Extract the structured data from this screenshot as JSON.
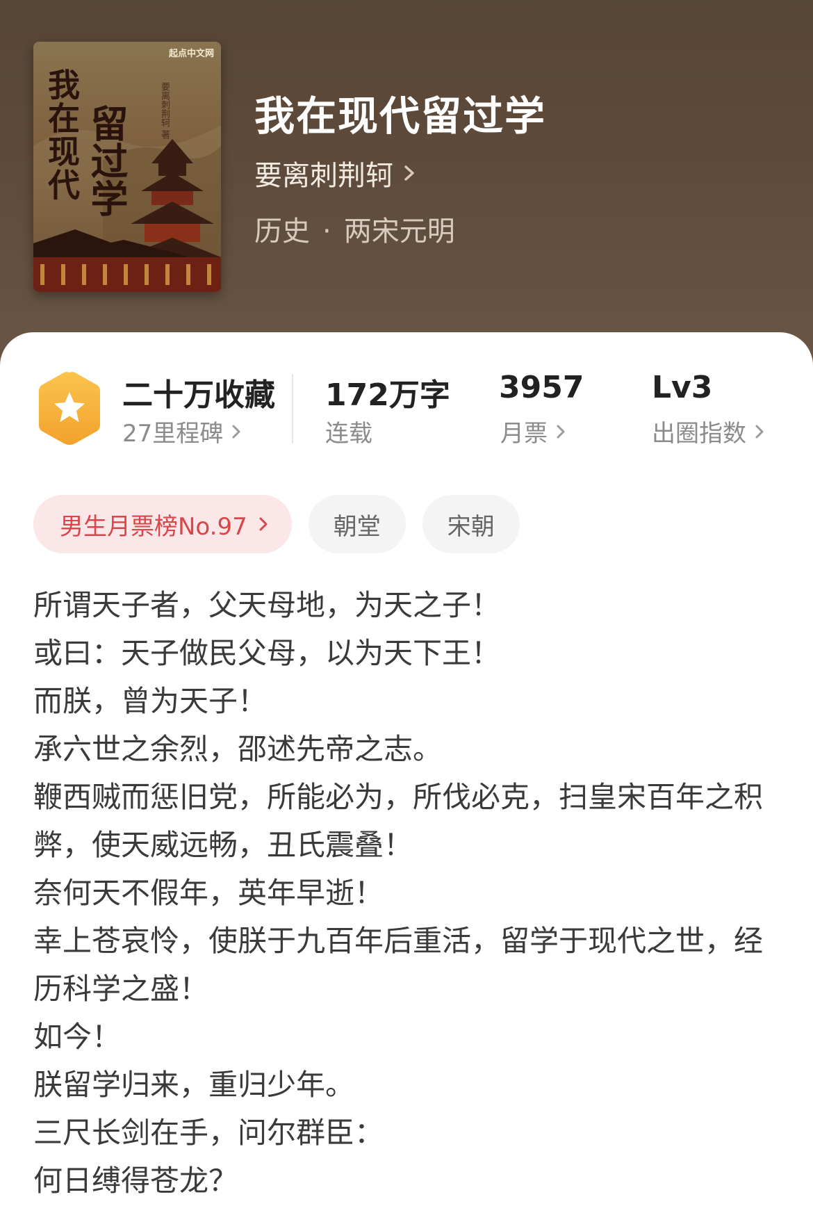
{
  "book": {
    "title": "我在现代留过学",
    "author": "要离刺荆轲",
    "category": "历史",
    "separator": "·",
    "subcategory": "两宋元明",
    "cover": {
      "publisher": "起点中文网",
      "title_line_a": "我在现代",
      "title_line_b": "留过学",
      "author": "要离刺荆轲 著"
    }
  },
  "stats": {
    "collection": {
      "value": "二十万收藏",
      "sub": "27里程碑"
    },
    "words": {
      "value": "172万字",
      "sub": "连载"
    },
    "monthly_votes": {
      "value": "3957",
      "sub": "月票"
    },
    "influence": {
      "value": "Lv3",
      "sub": "出圈指数"
    }
  },
  "tags": {
    "rank": "男生月票榜No.97",
    "items": [
      "朝堂",
      "宋朝"
    ]
  },
  "intro": [
    "所谓天子者，父天母地，为天之子！",
    "或曰：天子做民父母，以为天下王！",
    "而朕，曾为天子！",
    "承六世之余烈，邵述先帝之志。",
    "鞭西贼而惩旧党，所能必为，所伐必克，扫皇宋百年之积弊，使天威远畅，丑氏震叠！",
    "奈何天不假年，英年早逝！",
    "幸上苍哀怜，使朕于九百年后重活，留学于现代之世，经历科学之盛！",
    "如今！",
    "朕留学归来，重归少年。",
    "三尺长剑在手，问尔群臣：",
    "何日缚得苍龙？"
  ],
  "colors": {
    "header_bg": "#5f4b3b",
    "rank_tag_bg": "#fbe7e7",
    "rank_tag_text": "#d9454a",
    "badge": "#f7b23b"
  },
  "icons": {
    "badge": "star-hexagon-icon",
    "chevron": "chevron-right-icon"
  }
}
